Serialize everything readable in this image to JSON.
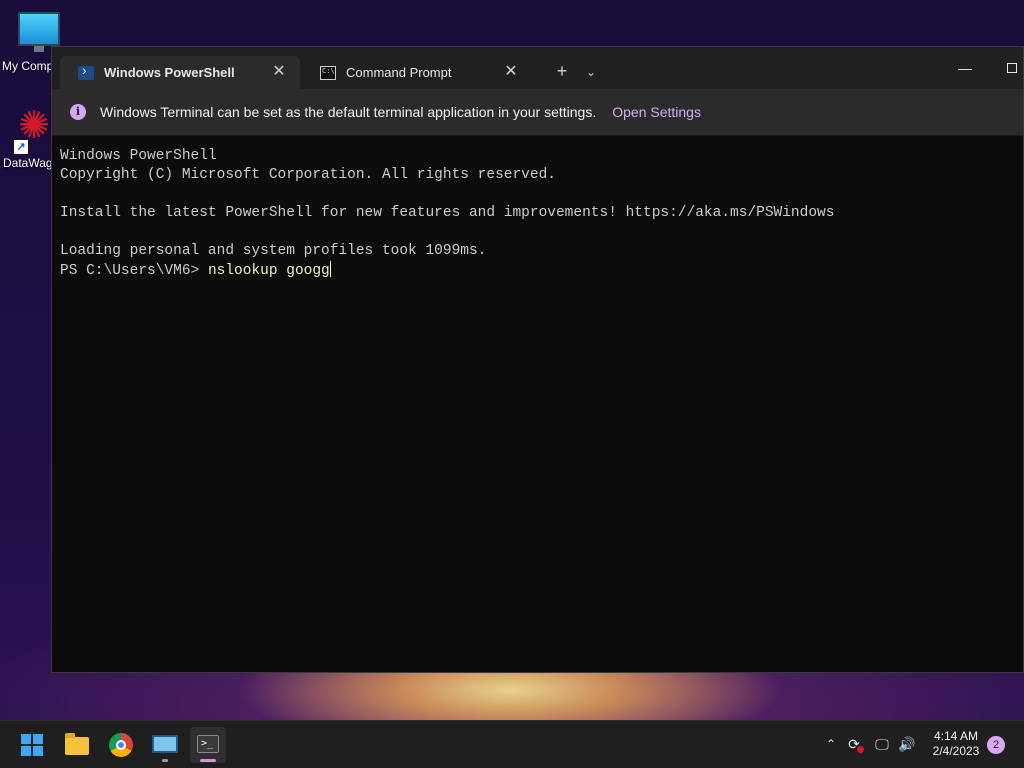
{
  "desktop": {
    "icons": [
      {
        "label": "My Comp",
        "icon": "computer-icon"
      },
      {
        "label": "DataWag",
        "icon": "datawag-app-icon"
      }
    ]
  },
  "terminal": {
    "tabs": [
      {
        "title": "Windows PowerShell",
        "icon": "powershell-icon",
        "active": true
      },
      {
        "title": "Command Prompt",
        "icon": "cmd-icon",
        "active": false
      }
    ],
    "tab_close_glyph": "✕",
    "new_tab_glyph": "+",
    "dropdown_glyph": "⌄",
    "minimize_glyph": "—",
    "infobar": {
      "icon_glyph": "i",
      "message": "Windows Terminal can be set as the default terminal application in your settings.",
      "link": "Open Settings"
    },
    "lines": [
      "Windows PowerShell",
      "Copyright (C) Microsoft Corporation. All rights reserved.",
      "",
      "Install the latest PowerShell for new features and improvements! https://aka.ms/PSWindows",
      "",
      "Loading personal and system profiles took 1099ms."
    ],
    "prompt": "PS C:\\Users\\VM6> ",
    "typed_command": "nslookup googg"
  },
  "taskbar": {
    "apps": [
      {
        "name": "Start",
        "icon": "windows-start-icon"
      },
      {
        "name": "File Explorer",
        "icon": "folder-icon"
      },
      {
        "name": "Google Chrome",
        "icon": "chrome-icon"
      },
      {
        "name": "Control Panel",
        "icon": "control-panel-icon"
      },
      {
        "name": "Terminal",
        "icon": "terminal-icon",
        "active": true
      }
    ],
    "tray": {
      "chevron_glyph": "⌃",
      "sync_glyph": "⟳",
      "network_glyph": "🖵",
      "volume_glyph": "🔊"
    },
    "clock": {
      "time": "4:14 AM",
      "date": "2/4/2023"
    },
    "notification_count": "2"
  },
  "colors": {
    "accent": "#d9a9f5",
    "terminal_bg": "#0c0c0c",
    "typed_text": "#f5f0c0"
  }
}
